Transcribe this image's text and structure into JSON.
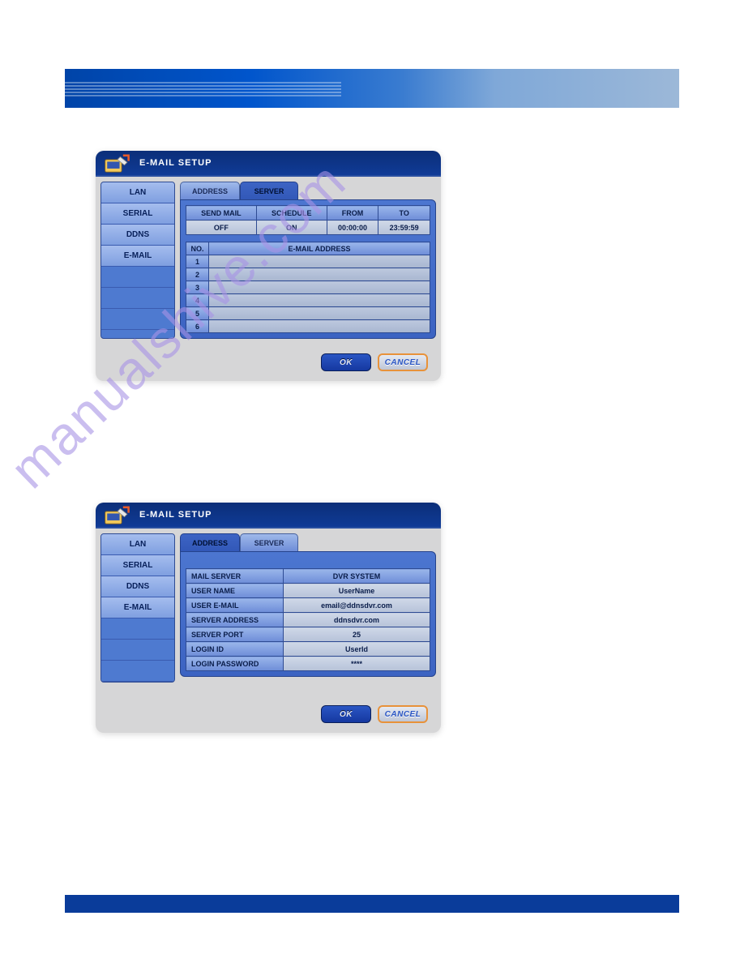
{
  "watermark": "manualshive.com",
  "dialog": {
    "title": "E-MAIL SETUP",
    "sidebar": [
      "LAN",
      "SERIAL",
      "DDNS",
      "E-MAIL"
    ],
    "tabs": {
      "address": "ADDRESS",
      "server": "SERVER"
    },
    "buttons": {
      "ok": "OK",
      "cancel": "CANCEL"
    }
  },
  "address_panel": {
    "headers": {
      "send_mail": "SEND MAIL",
      "schedule": "SCHEDULE",
      "from": "FROM",
      "to": "TO"
    },
    "values": {
      "send_mail": "OFF",
      "schedule": "ON",
      "from": "00:00:00",
      "to": "23:59:59"
    },
    "list_header": {
      "no": "NO.",
      "email": "E-MAIL ADDRESS"
    },
    "rows": [
      {
        "no": "1",
        "email": ""
      },
      {
        "no": "2",
        "email": ""
      },
      {
        "no": "3",
        "email": ""
      },
      {
        "no": "4",
        "email": ""
      },
      {
        "no": "5",
        "email": ""
      },
      {
        "no": "6",
        "email": ""
      }
    ]
  },
  "server_panel": {
    "header_label": "MAIL SERVER",
    "header_value": "DVR SYSTEM",
    "rows": [
      {
        "label": "USER NAME",
        "value": "UserName"
      },
      {
        "label": "USER E-MAIL",
        "value": "email@ddnsdvr.com"
      },
      {
        "label": "SERVER ADDRESS",
        "value": "ddnsdvr.com"
      },
      {
        "label": "SERVER PORT",
        "value": "25"
      },
      {
        "label": "LOGIN ID",
        "value": "UserId"
      },
      {
        "label": "LOGIN PASSWORD",
        "value": "****"
      }
    ]
  }
}
